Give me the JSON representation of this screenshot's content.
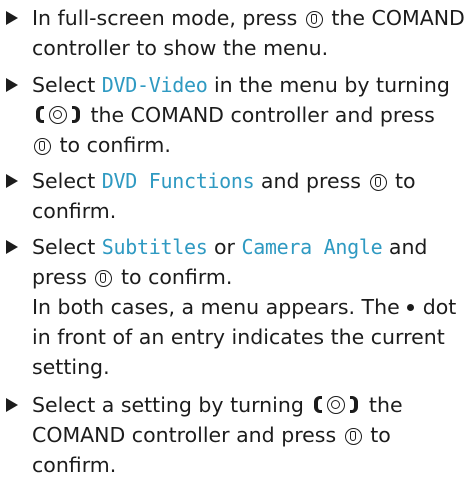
{
  "steps": [
    {
      "line1_pre": "In full-screen mode, press ",
      "line1_post": " the COMAND",
      "line2": "controller to show the menu."
    },
    {
      "line1_pre": "Select ",
      "menu_item": "DVD-Video",
      "line1_post": " in the menu by turning",
      "line2_post": " the COMAND controller and press",
      "line3_post": " to confirm."
    },
    {
      "line1_pre": "Select ",
      "menu_item": "DVD Functions",
      "line1_post": " and press ",
      "line1_end": " to",
      "line2": "confirm."
    },
    {
      "line1_pre": "Select ",
      "menu_item_a": "Subtitles",
      "line1_mid": " or ",
      "menu_item_b": "Camera Angle",
      "line1_post": " and",
      "line2_pre": "press ",
      "line2_post": " to confirm.",
      "result_line1_pre": "In both cases, a menu appears. The",
      "result_line1_post": "dot",
      "result_line2": "in front of an entry indicates the current",
      "result_line3": "setting."
    },
    {
      "line1_pre": "Select a setting by turning ",
      "line1_post": " the",
      "line2_pre": "COMAND controller and press ",
      "line2_post": " to",
      "line3": "confirm."
    }
  ],
  "colors": {
    "text": "#1c1c1c",
    "menu_item": "#2f9ac2",
    "background": "#ffffff"
  },
  "icons": {
    "bullet": "triangle-bullet-icon",
    "press": "press-controller-icon",
    "turn": "turn-controller-icon",
    "dot": "current-setting-dot-icon"
  }
}
